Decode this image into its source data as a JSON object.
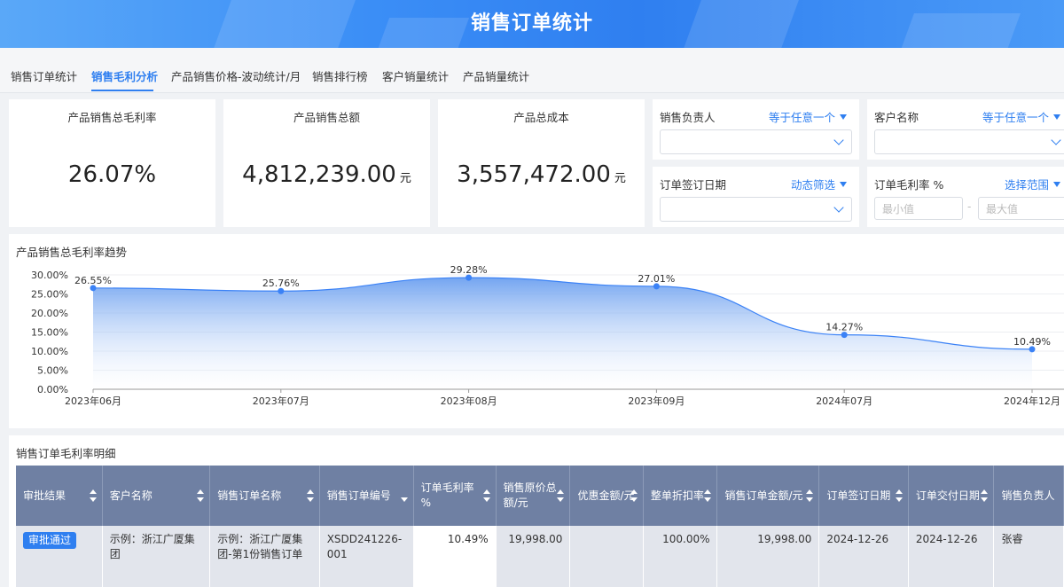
{
  "header": {
    "title": "销售订单统计"
  },
  "tabs": [
    {
      "label": "销售订单统计"
    },
    {
      "label": "销售毛利分析",
      "active": true
    },
    {
      "label": "产品销售价格-波动统计/月"
    },
    {
      "label": "销售排行榜"
    },
    {
      "label": "客户销量统计"
    },
    {
      "label": "产品销量统计"
    }
  ],
  "kpis": [
    {
      "title": "产品销售总毛利率",
      "value": "26.07%",
      "unit": ""
    },
    {
      "title": "产品销售总额",
      "value": "4,812,239.00",
      "unit": "元"
    },
    {
      "title": "产品总成本",
      "value": "3,557,472.00",
      "unit": "元"
    }
  ],
  "filters": {
    "sales_rep": {
      "label": "销售负责人",
      "mode": "等于任意一个"
    },
    "customer": {
      "label": "客户名称",
      "mode": "等于任意一个"
    },
    "sign_date": {
      "label": "订单签订日期",
      "mode": "动态筛选"
    },
    "margin": {
      "label": "订单毛利率 %",
      "mode": "选择范围",
      "min_placeholder": "最小值",
      "max_placeholder": "最大值",
      "separator": "-"
    }
  },
  "trend": {
    "title": "产品销售总毛利率趋势"
  },
  "chart_data": {
    "type": "area",
    "title": "产品销售总毛利率趋势",
    "categories": [
      "2023年06月",
      "2023年07月",
      "2023年08月",
      "2023年09月",
      "2024年07月",
      "2024年12月"
    ],
    "values": [
      26.55,
      25.76,
      29.28,
      27.01,
      14.27,
      10.49
    ],
    "data_labels": [
      "26.55%",
      "25.76%",
      "29.28%",
      "27.01%",
      "14.27%",
      "10.49%"
    ],
    "y_ticks": [
      "30.00%",
      "25.00%",
      "20.00%",
      "15.00%",
      "10.00%",
      "5.00%",
      "0.00%"
    ],
    "ylim": [
      0,
      30
    ],
    "grid": true,
    "color": "#3b82f6"
  },
  "detail": {
    "title": "销售订单毛利率明细",
    "columns": [
      "审批结果",
      "客户名称",
      "销售订单名称",
      "销售订单编号",
      "订单毛利率%",
      "销售原价总额/元",
      "优惠金额/元",
      "整单折扣率",
      "销售订单金额/元",
      "订单签订日期",
      "订单交付日期",
      "销售负责人"
    ],
    "header_lines": [
      [
        "审批结果"
      ],
      [
        "客户名称"
      ],
      [
        "销售订单名称"
      ],
      [
        "销售订单编号"
      ],
      [
        "订单毛利率",
        "%"
      ],
      [
        "销售原价总",
        "额/元"
      ],
      [
        "优惠金额/元"
      ],
      [
        "整单折扣率"
      ],
      [
        "销售订单金额/元"
      ],
      [
        "订单签订日期"
      ],
      [
        "订单交付日期"
      ],
      [
        "销售负责人"
      ]
    ],
    "rows": [
      {
        "status": "审批通过",
        "customer": "示例：浙江广厦集团",
        "order_name": "示例：浙江广厦集团-第1份销售订单",
        "order_no": "XSDD241226-001",
        "margin": "10.49%",
        "original_total": "19,998.00",
        "discount_amount": "",
        "discount_rate": "100.00%",
        "order_amount": "19,998.00",
        "sign_date": "2024-12-26",
        "delivery_date": "2024-12-26",
        "sales_rep": "张睿"
      }
    ]
  },
  "colors": {
    "accent": "#2f7ff0",
    "table_header": "#6f80a3",
    "negative": "#e0302c"
  }
}
